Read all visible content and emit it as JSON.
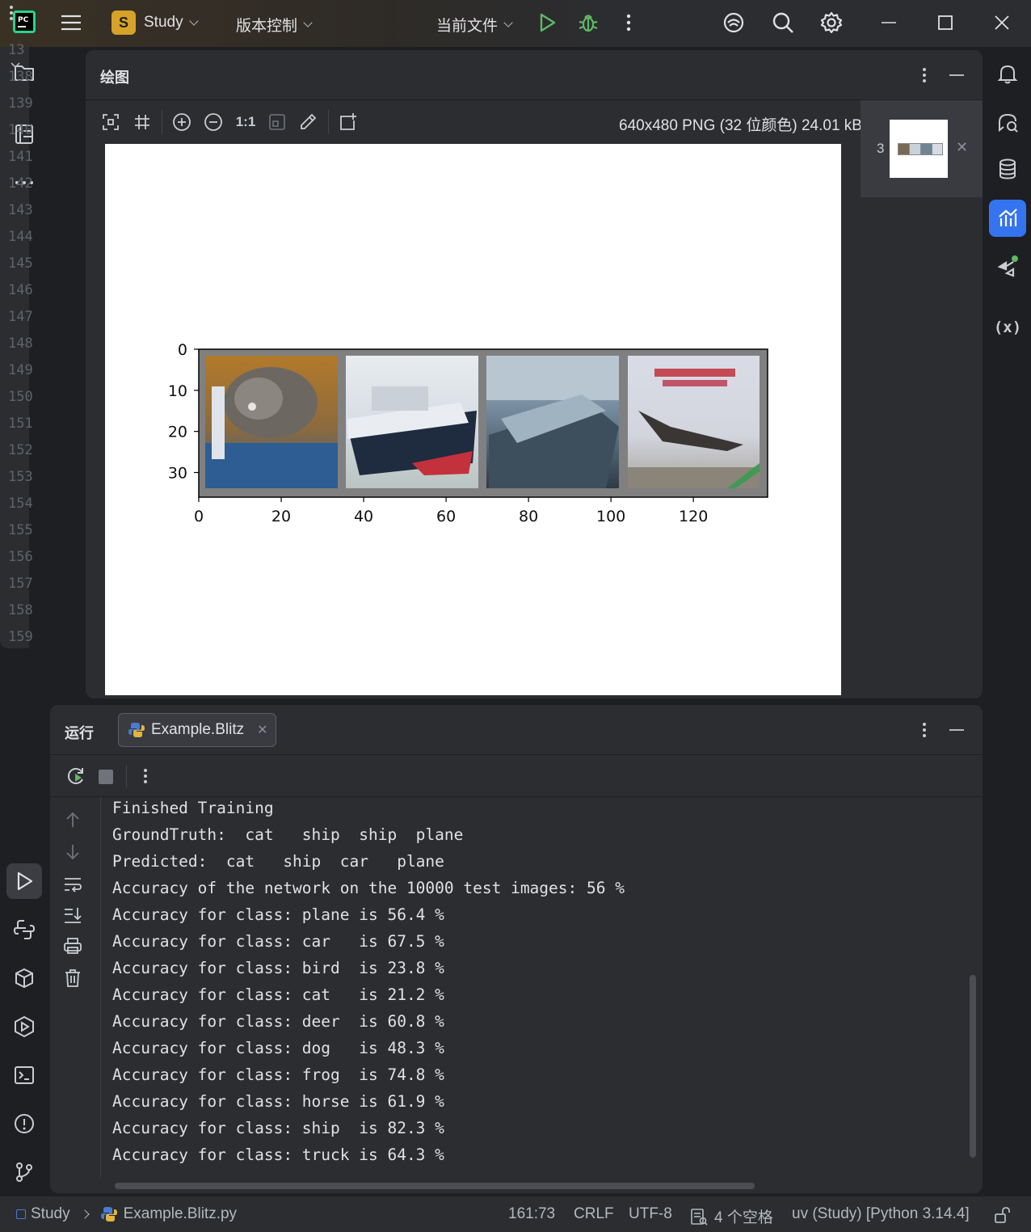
{
  "titlebar": {
    "project_badge": "S",
    "project_name": "Study",
    "vcs_label": "版本控制",
    "run_config": "当前文件"
  },
  "gutter": {
    "line_numbers": [
      "13",
      "138",
      "139",
      "140",
      "141",
      "142",
      "143",
      "144",
      "145",
      "146",
      "147",
      "148",
      "149",
      "150",
      "151",
      "152",
      "153",
      "154",
      "155",
      "156",
      "157",
      "158",
      "159"
    ]
  },
  "plots": {
    "title": "绘图",
    "zoom_actual_label": "1:1",
    "image_info": "640x480 PNG (32 位颜色) 24.01 kB",
    "thumbnail_number": "3"
  },
  "chart_data": {
    "type": "image",
    "title": "",
    "xlabel": "",
    "ylabel": "",
    "xlim": [
      0,
      138
    ],
    "ylim": [
      36,
      0
    ],
    "x_ticks": [
      "0",
      "20",
      "40",
      "60",
      "80",
      "100",
      "120"
    ],
    "y_ticks": [
      "0",
      "10",
      "20",
      "30"
    ],
    "images": [
      "cat",
      "ship",
      "ship",
      "plane"
    ]
  },
  "run": {
    "title": "运行",
    "tab_label": "Example.Blitz",
    "output": [
      "Finished Training",
      "GroundTruth:  cat   ship  ship  plane",
      "Predicted:  cat   ship  car   plane",
      "Accuracy of the network on the 10000 test images: 56 %",
      "Accuracy for class: plane is 56.4 %",
      "Accuracy for class: car   is 67.5 %",
      "Accuracy for class: bird  is 23.8 %",
      "Accuracy for class: cat   is 21.2 %",
      "Accuracy for class: deer  is 60.8 %",
      "Accuracy for class: dog   is 48.3 %",
      "Accuracy for class: frog  is 74.8 %",
      "Accuracy for class: horse is 61.9 %",
      "Accuracy for class: ship  is 82.3 %",
      "Accuracy for class: truck is 64.3 %"
    ]
  },
  "statusbar": {
    "project": "Study",
    "file": "Example.Blitz.py",
    "position": "161:73",
    "line_sep": "CRLF",
    "encoding": "UTF-8",
    "indent": "4 个空格",
    "interpreter": "uv (Study) [Python 3.14.4]"
  },
  "colors": {
    "accent": "#3574f0",
    "run_green": "#5fb865",
    "project_badge": "#d6a22a"
  }
}
